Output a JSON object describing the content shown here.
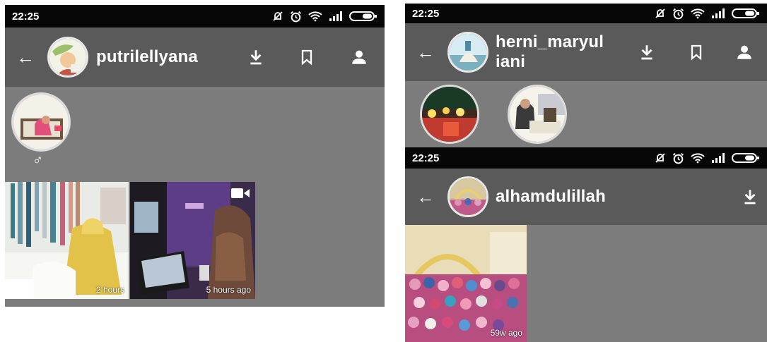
{
  "left_screen": {
    "status_time": "22:25",
    "username": "putrilellyana",
    "stories": [
      {
        "badge": "♂"
      }
    ],
    "posts": [
      {
        "timestamp": "2 hours"
      },
      {
        "timestamp": "5 hours ago",
        "video": true
      }
    ]
  },
  "right_top_screen": {
    "status_time": "22:25",
    "username_line1": "herni_maryul",
    "username_line2": "iani"
  },
  "right_bottom_screen": {
    "status_time": "22:25",
    "username": "alhamdulillah",
    "posts": [
      {
        "timestamp": "59w ago"
      }
    ]
  },
  "colors": {
    "status_bar": "#070707",
    "app_bar": "#5a5a5a",
    "content": "#7c7c7c"
  },
  "icons": [
    "mute-icon",
    "alarm-icon",
    "wifi-icon",
    "signal-icon",
    "battery-icon",
    "back-arrow-icon",
    "download-icon",
    "bookmark-icon",
    "profile-icon",
    "video-icon"
  ]
}
